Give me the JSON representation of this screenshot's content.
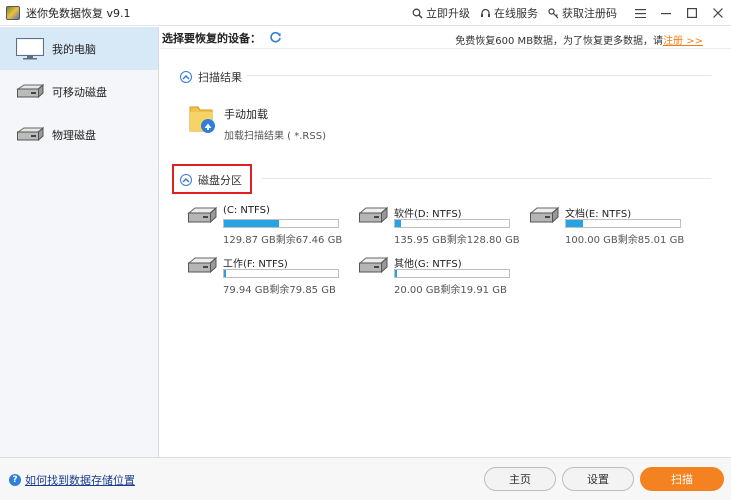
{
  "window": {
    "title": "迷你免数据恢复 v9.1",
    "links": {
      "upgrade": "立即升级",
      "service": "在线服务",
      "regcode": "获取注册码"
    }
  },
  "sidebar": {
    "items": [
      {
        "label": "我的电脑",
        "icon": "monitor-icon",
        "active": true
      },
      {
        "label": "可移动磁盘",
        "icon": "removable-disk-icon",
        "active": false
      },
      {
        "label": "物理磁盘",
        "icon": "physical-disk-icon",
        "active": false
      }
    ]
  },
  "main": {
    "select_label": "选择要恢复的设备：",
    "promo_text": "免费恢复600 MB数据，为了恢复更多数据，请",
    "promo_link": "注册 >>",
    "scan_results": {
      "title": "扫描结果",
      "manual_title": "手动加载",
      "manual_desc": "加载扫描结果 ( *.RSS)"
    },
    "partitions": {
      "title": "磁盘分区",
      "drives": [
        {
          "name": "(C: NTFS)",
          "size": "129.87 GB剩余67.46 GB",
          "used_fraction": 0.48
        },
        {
          "name": "软件(D: NTFS)",
          "size": "135.95 GB剩余128.80 GB",
          "used_fraction": 0.05
        },
        {
          "name": "文档(E: NTFS)",
          "size": "100.00 GB剩余85.01 GB",
          "used_fraction": 0.15
        },
        {
          "name": "工作(F: NTFS)",
          "size": "79.94 GB剩余79.85 GB",
          "used_fraction": 0.01
        },
        {
          "name": "其他(G: NTFS)",
          "size": "20.00 GB剩余19.91 GB",
          "used_fraction": 0.01
        }
      ]
    }
  },
  "bottom": {
    "help": "如何找到数据存储位置",
    "home": "主页",
    "settings": "设置",
    "scan": "扫描"
  },
  "colors": {
    "accent_orange": "#f58220",
    "bar_blue": "#27a3e3",
    "highlight_red": "#e02020"
  }
}
